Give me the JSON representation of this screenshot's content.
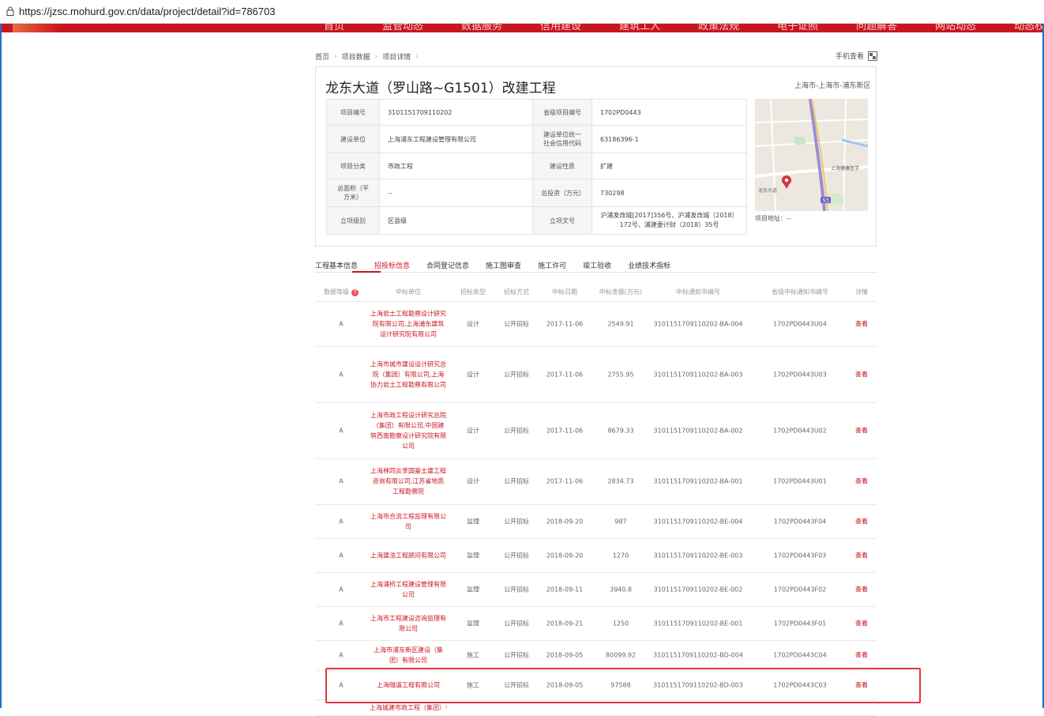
{
  "browser": {
    "url": "https://jzsc.mohurd.gov.cn/data/project/detail?id=786703"
  },
  "topnav": {
    "items": [
      "首页",
      "监管动态",
      "数据服务",
      "信用建设",
      "建筑工人",
      "政策法规",
      "电子证照",
      "问题解答",
      "网站动态",
      "动态权重"
    ]
  },
  "breadcrumb": {
    "home": "首页",
    "data": "项目数据",
    "detail": "项目详情"
  },
  "mobile_view": "手机查看",
  "project": {
    "title": "龙东大道（罗山路~G1501）改建工程",
    "region": "上海市-上海市-浦东新区",
    "info": [
      {
        "k1": "项目编号",
        "v1": "3101151709110202",
        "k2": "省级项目编号",
        "v2": "1702PD0443"
      },
      {
        "k1": "建设单位",
        "v1": "上海浦东工程建设管理有限公司",
        "k2": "建设单位统一社会信用代码",
        "v2": "63186396-1"
      },
      {
        "k1": "项目分类",
        "v1": "市政工程",
        "k2": "建设性质",
        "v2": "扩建"
      },
      {
        "k1": "总面积（平方米）",
        "v1": "--",
        "k2": "总投资（万元）",
        "v2": "730298"
      },
      {
        "k1": "立项级别",
        "v1": "区县级",
        "k2": "立项文号",
        "v2": "沪浦发改城[2017]356号、沪浦发改城（2018）172号、浦建委计财（2018）35号"
      }
    ],
    "map_labels": {
      "place1": "上海健康医学",
      "place2": "龙东大道",
      "badge": "S3"
    },
    "address_label": "项目地址：--"
  },
  "tabs": [
    {
      "label": "工程基本信息",
      "active": false
    },
    {
      "label": "招投标信息",
      "active": true
    },
    {
      "label": "合同登记信息",
      "active": false
    },
    {
      "label": "施工图审查",
      "active": false
    },
    {
      "label": "施工许可",
      "active": false
    },
    {
      "label": "竣工验收",
      "active": false
    },
    {
      "label": "业绩技术指标",
      "active": false
    }
  ],
  "table": {
    "headers": [
      "数据等级",
      "中标单位",
      "招标类型",
      "招标方式",
      "中标日期",
      "中标金额(万元)",
      "中标通知书编号",
      "省级中标通知书编号",
      "详情"
    ],
    "rows": [
      {
        "level": "A",
        "unit": "上海岩土工程勘察设计研究院有限公司,上海浦东建筑设计研究院有限公司",
        "type": "设计",
        "method": "公开招标",
        "date": "2017-11-06",
        "amount": "2549.91",
        "notice": "3101151709110202-BA-004",
        "prov": "1702PD0443U04",
        "view": "查看"
      },
      {
        "level": "A",
        "unit": "上海市城市建设设计研究总院（集团）有限公司,上海协力岩土工程勘察有限公司",
        "type": "设计",
        "method": "公开招标",
        "date": "2017-11-06",
        "amount": "2755.95",
        "notice": "3101151709110202-BA-003",
        "prov": "1702PD0443U03",
        "view": "查看"
      },
      {
        "level": "A",
        "unit": "上海市政工程设计研究总院（集团）有限公司,中国建筑西南勘察设计研究院有限公司",
        "type": "设计",
        "method": "公开招标",
        "date": "2017-11-06",
        "amount": "8679.33",
        "notice": "3101151709110202-BA-002",
        "prov": "1702PD0443U02",
        "view": "查看"
      },
      {
        "level": "A",
        "unit": "上海林同炎李国豪土建工程咨询有限公司,江苏省地质工程勘察院",
        "type": "设计",
        "method": "公开招标",
        "date": "2017-11-06",
        "amount": "2834.73",
        "notice": "3101151709110202-BA-001",
        "prov": "1702PD0443U01",
        "view": "查看"
      },
      {
        "level": "A",
        "unit": "上海市合流工程监理有限公司",
        "type": "监理",
        "method": "公开招标",
        "date": "2018-09-20",
        "amount": "987",
        "notice": "3101151709110202-BE-004",
        "prov": "1702PD0443F04",
        "view": "查看"
      },
      {
        "level": "A",
        "unit": "上海建浩工程顾问有限公司",
        "type": "监理",
        "method": "公开招标",
        "date": "2018-09-20",
        "amount": "1270",
        "notice": "3101151709110202-BE-003",
        "prov": "1702PD0443F03",
        "view": "查看"
      },
      {
        "level": "A",
        "unit": "上海浦桥工程建设管理有限公司",
        "type": "监理",
        "method": "公开招标",
        "date": "2018-09-11",
        "amount": "3940.8",
        "notice": "3101151709110202-BE-002",
        "prov": "1702PD0443F02",
        "view": "查看"
      },
      {
        "level": "A",
        "unit": "上海市工程建设咨询监理有限公司",
        "type": "监理",
        "method": "公开招标",
        "date": "2018-09-21",
        "amount": "1250",
        "notice": "3101151709110202-BE-001",
        "prov": "1702PD0443F01",
        "view": "查看"
      },
      {
        "level": "A",
        "unit": "上海市浦东新区建设（集团）有限公司",
        "type": "施工",
        "method": "公开招标",
        "date": "2018-09-05",
        "amount": "80099.92",
        "notice": "3101151709110202-BD-004",
        "prov": "1702PD0443C04",
        "view": "查看"
      },
      {
        "level": "A",
        "unit": "上海隧道工程有限公司",
        "type": "施工",
        "method": "公开招标",
        "date": "2018-09-05",
        "amount": "97588",
        "notice": "3101151709110202-BD-003",
        "prov": "1702PD0443C03",
        "view": "查看"
      },
      {
        "level": "",
        "unit": "上海城建市政工程（集团）有限公司",
        "type": "",
        "method": "",
        "date": "",
        "amount": "",
        "notice": "",
        "prov": "",
        "view": ""
      }
    ]
  },
  "colors": {
    "accent": "#c9151e",
    "highlight": "#e0353d",
    "frame": "#1e6fd0"
  }
}
